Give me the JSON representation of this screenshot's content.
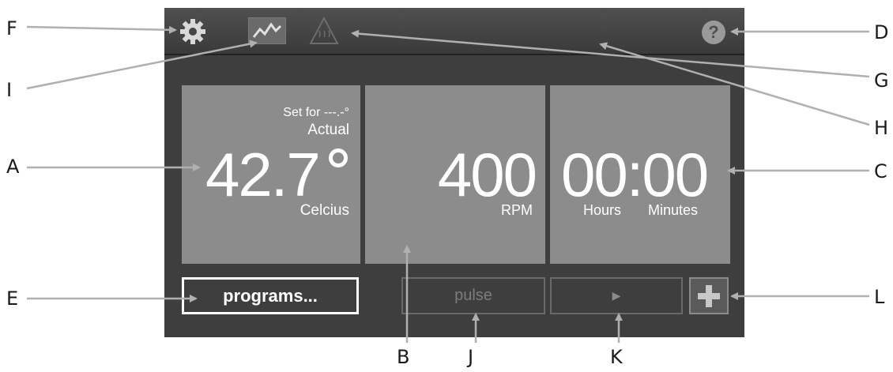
{
  "callouts": [
    "A",
    "B",
    "C",
    "D",
    "E",
    "F",
    "G",
    "H",
    "I",
    "J",
    "K",
    "L"
  ],
  "icons": {
    "settings": "gear-icon",
    "graph": "chart-icon",
    "heat_warning": "heat-warning-icon",
    "help": "help-icon",
    "play": "play-icon",
    "add": "plus-icon"
  },
  "temperature": {
    "set_label": "Set for ---.-°",
    "actual_label": "Actual",
    "value": "42.7",
    "unit": "Celcius"
  },
  "speed": {
    "value": "400",
    "unit": "RPM"
  },
  "timer": {
    "value": "00:00",
    "hours_label": "Hours",
    "minutes_label": "Minutes"
  },
  "buttons": {
    "programs": "programs...",
    "pulse": "pulse",
    "play": "▶",
    "help": "?"
  },
  "colors": {
    "screen_bg": "#3e3e3e",
    "tile_bg": "#8c8c8c",
    "disabled_text": "#9a9a9a"
  }
}
